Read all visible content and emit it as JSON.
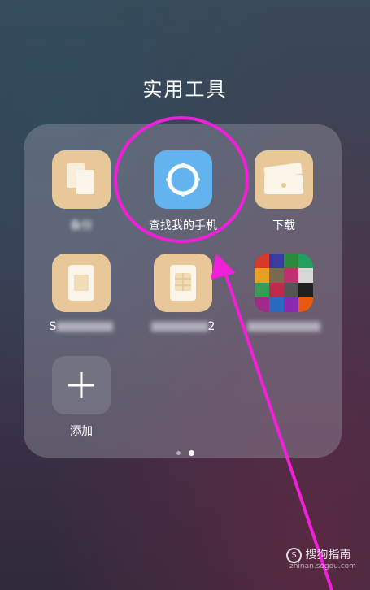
{
  "folder": {
    "title": "实用工具"
  },
  "apps": [
    {
      "label": "备份",
      "icon": "backup-icon",
      "blurred": true
    },
    {
      "label": "查找我的手机",
      "icon": "find-my-phone-icon",
      "blurred": false
    },
    {
      "label": "下载",
      "icon": "download-icon",
      "blurred": false
    },
    {
      "label": "S",
      "icon": "sim-card-icon",
      "blurred": true
    },
    {
      "label": "2",
      "icon": "sim-card-2-icon",
      "blurred": true
    },
    {
      "label": "",
      "icon": "mosaic-app-icon",
      "blurred": true
    },
    {
      "label": "添加",
      "icon": "plus-icon",
      "blurred": false
    }
  ],
  "pagination": {
    "pages": 2,
    "current": 2
  },
  "watermark": {
    "brand": "搜狗指南",
    "url": "zhinan.sogou.com"
  },
  "colors": {
    "annotation": "#f01fd8",
    "icon_tan": "#e8c898",
    "icon_blue": "#63b3ef"
  }
}
